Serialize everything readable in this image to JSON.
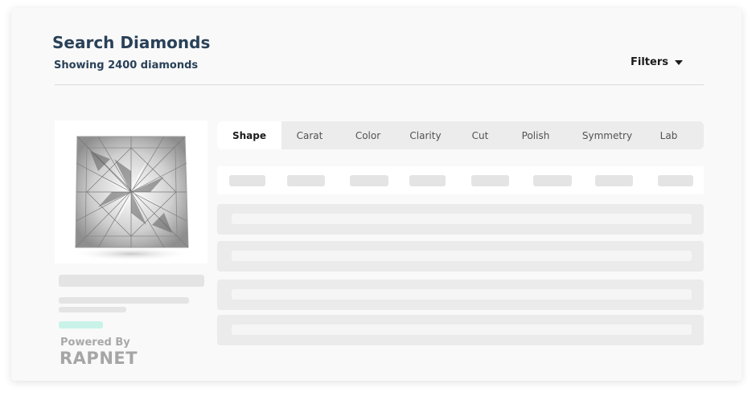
{
  "header": {
    "title": "Search Diamonds",
    "subtitle": "Showing 2400 diamonds",
    "filters_label": "Filters"
  },
  "tabs": [
    {
      "label": "Shape",
      "active": true
    },
    {
      "label": "Carat",
      "active": false
    },
    {
      "label": "Color",
      "active": false
    },
    {
      "label": "Clarity",
      "active": false
    },
    {
      "label": "Cut",
      "active": false
    },
    {
      "label": "Polish",
      "active": false
    },
    {
      "label": "Symmetry",
      "active": false
    },
    {
      "label": "Lab",
      "active": false
    }
  ],
  "branding": {
    "powered_by": "Powered By",
    "logo": "RAPNET"
  },
  "colors": {
    "title": "#2a4158",
    "accent_skeleton": "#c9f2e8"
  },
  "icons": {
    "filters": "caret-down-icon"
  }
}
